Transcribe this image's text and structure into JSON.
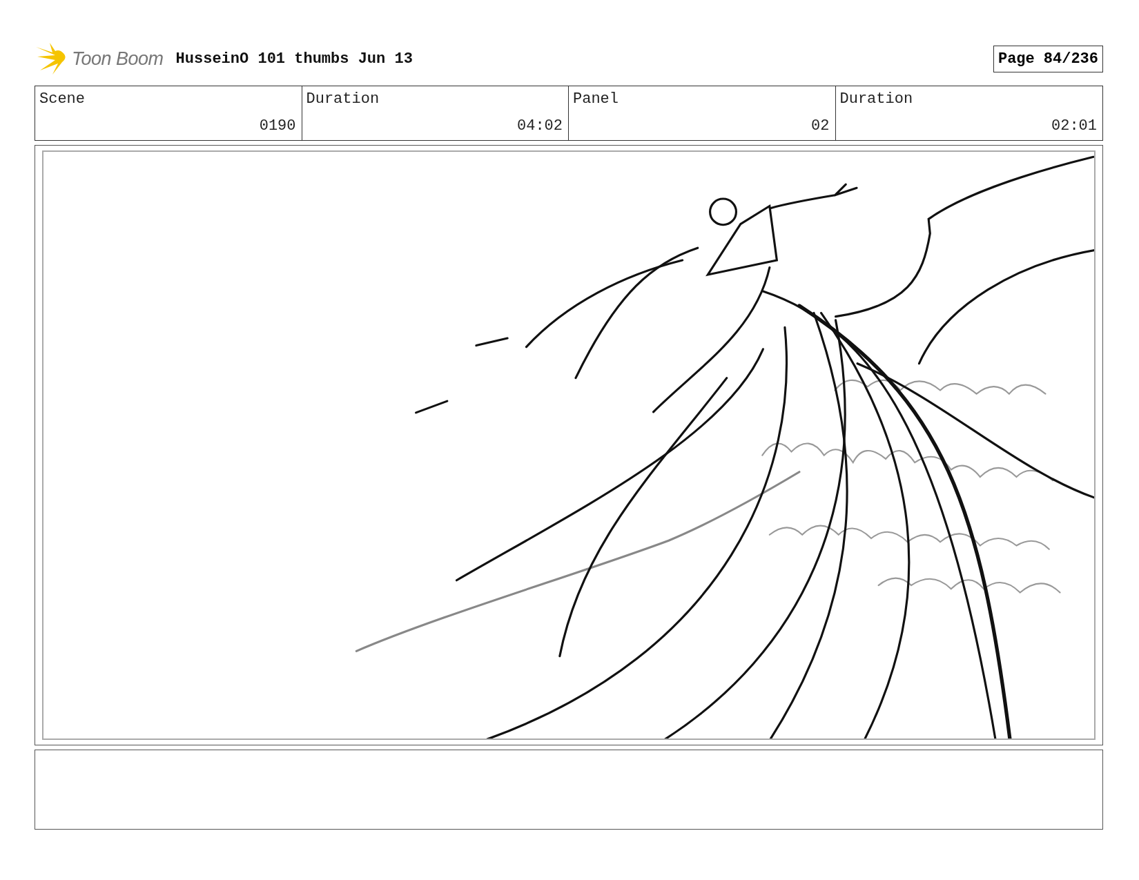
{
  "header": {
    "logo_text": "Toon Boom",
    "title": "HusseinO 101 thumbs Jun 13",
    "page_label": "Page",
    "page_value": "84/236"
  },
  "info_table": {
    "columns": [
      "Scene",
      "Duration",
      "Panel",
      "Duration"
    ],
    "rows": [
      [
        "0190",
        "04:02",
        "02",
        "02:01"
      ]
    ]
  }
}
